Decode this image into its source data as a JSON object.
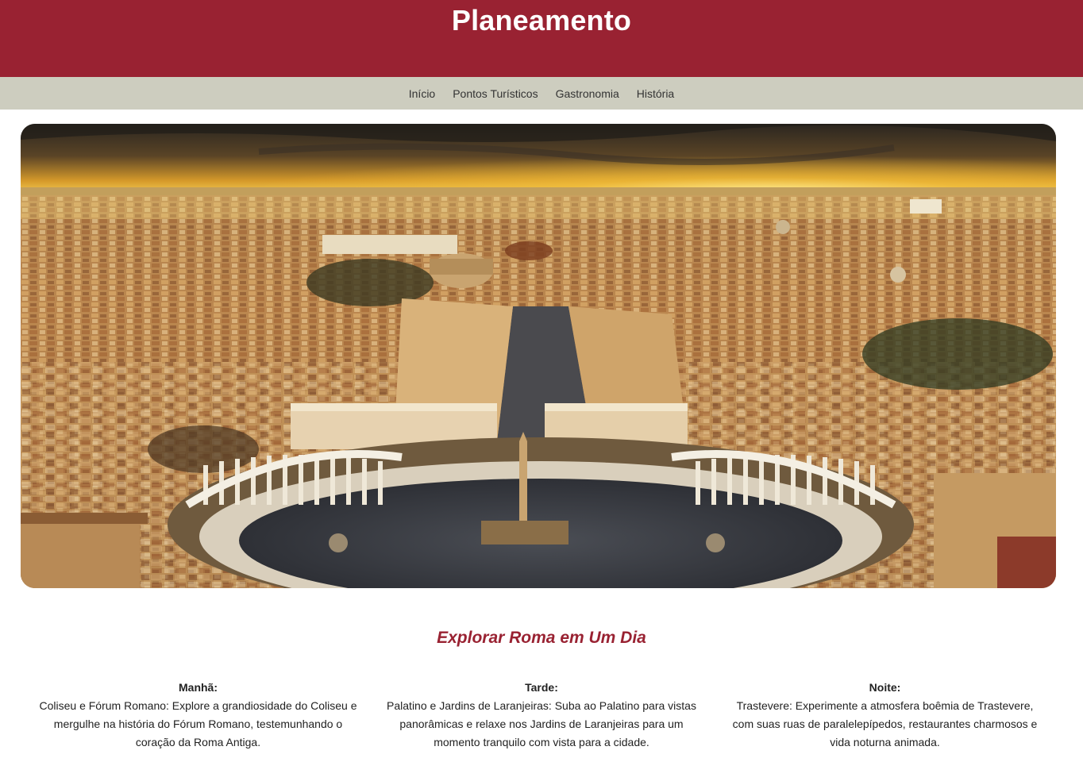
{
  "header": {
    "title": "Planeamento"
  },
  "nav": {
    "items": [
      {
        "label": "Início"
      },
      {
        "label": "Pontos Turísticos"
      },
      {
        "label": "Gastronomia"
      },
      {
        "label": "História"
      }
    ]
  },
  "hero": {
    "image_subject": "aerial-view-rome-st-peters-square-sunset"
  },
  "main": {
    "section_title": "Explorar Roma em Um Dia",
    "columns": [
      {
        "title": "Manhã:",
        "text": "Coliseu e Fórum Romano: Explore a grandiosidade do Coliseu e mergulhe na história do Fórum Romano, testemunhando o coração da Roma Antiga."
      },
      {
        "title": "Tarde:",
        "text": "Palatino e Jardins de Laranjeiras: Suba ao Palatino para vistas panorâmicas e relaxe nos Jardins de Laranjeiras para um momento tranquilo com vista para a cidade."
      },
      {
        "title": "Noite:",
        "text": "Trastevere: Experimente a atmosfera boêmia de Trastevere, com suas ruas de paralelepípedos, restaurantes charmosos e vida noturna animada."
      }
    ]
  },
  "colors": {
    "brand": "#992232",
    "nav_bg": "#cdcdbf",
    "title_accent": "#992232"
  }
}
